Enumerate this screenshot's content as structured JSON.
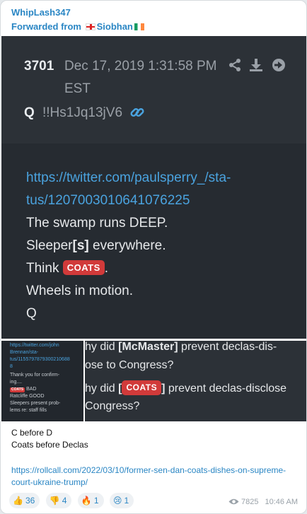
{
  "message": {
    "sender": "WhipLash347",
    "forwarded_prefix": "Forwarded from",
    "forwarded_name": "Siobhan",
    "caption_lines": [
      "C before D",
      "Coats before Declas"
    ],
    "link": "https://rollcall.com/2022/03/10/former-sen-dan-coats-dishes-on-supreme-court-ukraine-trump/",
    "views": "7825",
    "time": "10:46 AM"
  },
  "post": {
    "number": "3701",
    "date": "Dec 17, 2019 1:31:58 PM",
    "tz": "EST",
    "author": "Q",
    "trip": "!!Hs1Jq13jV6",
    "link_line1": "https://twitter.com/paulsperry_/sta-",
    "link_line2": "tus/1207003010641076225",
    "line_swamp": "The swamp runs DEEP.",
    "line_sleeper_a": "Sleeper",
    "line_sleeper_b": "[s]",
    "line_sleeper_c": " everywhere.",
    "line_think": "Think ",
    "line_coats": "COATS",
    "line_think_end": ".",
    "line_wheels": "Wheels in motion.",
    "line_q": "Q",
    "share_icon": "share-icon",
    "download_icon": "download-icon",
    "forward_icon": "arrow-right-icon",
    "link_icon": "link-icon"
  },
  "thumb": {
    "l1": "https://twitter.com/john",
    "l2": "Brennan/sta-",
    "l3": "tus/1155797879300210688",
    "l4": "8",
    "l5": "Thank you for confirm-",
    "l6": "ing....",
    "badge": "COATS",
    "l7": " BAD",
    "l8": "Ratcliffe GOOD",
    "l9": "Sleepers present prob-",
    "l10": "lems re: staff fills"
  },
  "mid": {
    "l1a": "hy did ",
    "l1b": "[McMaster]",
    "l1c": " prevent declas-dis-",
    "l2": "ose to Congress?",
    "l3a": "hy did ",
    "l3b": "[",
    "l3c": "COATS",
    "l3d": "]",
    "l3e": " prevent declas-disclose",
    "l4": "Congress?"
  },
  "reactions": [
    {
      "emoji": "👍",
      "count": "36"
    },
    {
      "emoji": "👎",
      "count": "4"
    },
    {
      "emoji": "🔥",
      "count": "1"
    },
    {
      "emoji": "😢",
      "count": "1"
    }
  ]
}
